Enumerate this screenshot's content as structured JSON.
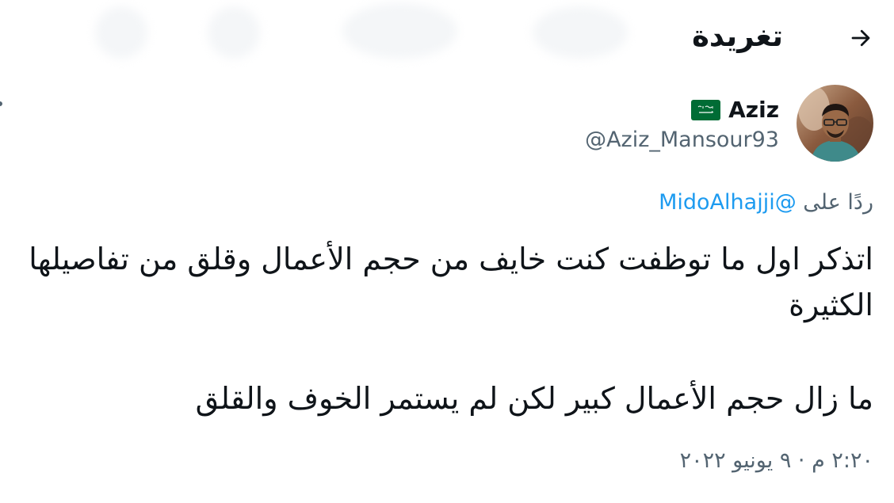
{
  "header": {
    "title": "تغريدة",
    "back_icon": "arrow-right-icon"
  },
  "author": {
    "display_name": "Aziz",
    "handle": "@Aziz_Mansour93",
    "flag_icon": "saudi-flag-icon",
    "avatar_icon": "user-avatar-photo"
  },
  "reply": {
    "prefix": "ردًا على",
    "mention": "@MidoAlhajji"
  },
  "tweet": {
    "line1": "اتذكر اول ما توظفت كنت خايف من حجم الأعمال وقلق من تفاصيلها الكثيرة",
    "line2": "ما زال حجم الأعمال كبير لكن لم يستمر الخوف والقلق"
  },
  "meta": {
    "timestamp": "٢:٢٠ م · ٩ يونيو ٢٠٢٢"
  },
  "colors": {
    "text_primary": "#0f1419",
    "text_secondary": "#536471",
    "link": "#1d9bf0",
    "flag_green": "#006c35"
  }
}
